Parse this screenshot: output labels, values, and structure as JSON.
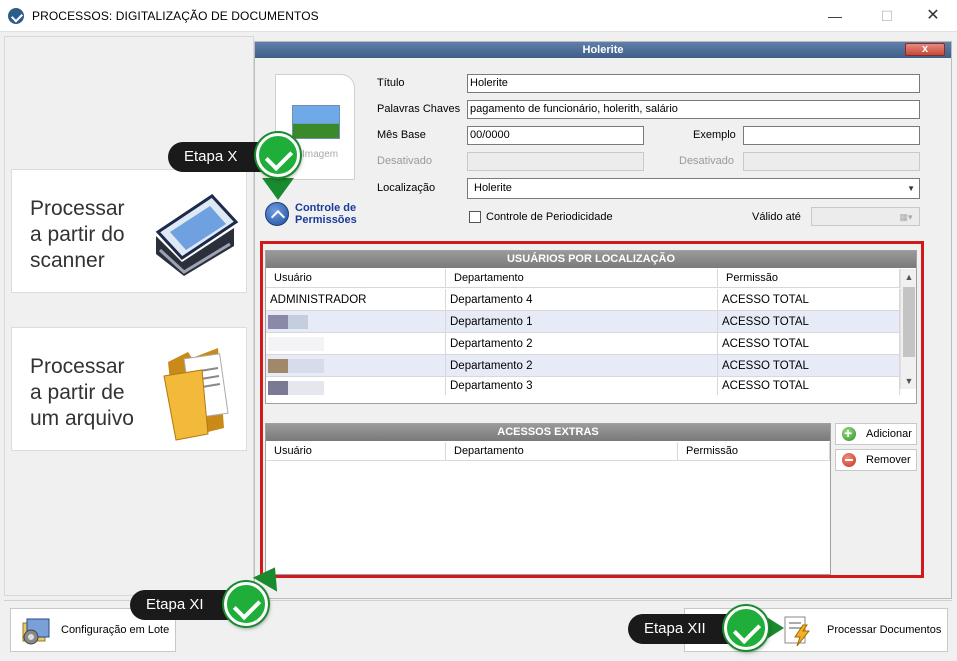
{
  "window": {
    "title": "PROCESSOS: DIGITALIZAÇÃO DE DOCUMENTOS",
    "minimize": "—",
    "maximize": "☐",
    "close": "✕"
  },
  "left": {
    "scanner_label": "Processar\na partir do\nscanner",
    "file_label": "Processar\na partir de\num arquivo"
  },
  "panel": {
    "title": "Holerite",
    "close": "x",
    "image_caption": "Imagem",
    "permissions_label": "Controle de\nPermissões"
  },
  "form": {
    "titulo_label": "Título",
    "titulo_value": "Holerite",
    "palavras_label": "Palavras Chaves",
    "palavras_value": "pagamento de funcionário, holerith, salário",
    "mes_label": "Mês Base",
    "mes_value": "00/0000",
    "exemplo_label": "Exemplo",
    "exemplo_value": "",
    "desativado1_label": "Desativado",
    "desativado2_label": "Desativado",
    "localizacao_label": "Localização",
    "localizacao_value": "Holerite",
    "periodicidade_label": "Controle de Periodicidade",
    "valido_label": "Válido até"
  },
  "usuarios": {
    "title": "USUÁRIOS POR LOCALIZAÇÃO",
    "columns": [
      "Usuário",
      "Departamento",
      "Permissão"
    ],
    "rows": [
      {
        "usuario": "ADMINISTRADOR",
        "departamento": "Departamento 4",
        "permissao": "ACESSO TOTAL"
      },
      {
        "usuario": "",
        "departamento": "Departamento 1",
        "permissao": "ACESSO TOTAL"
      },
      {
        "usuario": "",
        "departamento": "Departamento 2",
        "permissao": "ACESSO TOTAL"
      },
      {
        "usuario": "",
        "departamento": "Departamento 2",
        "permissao": "ACESSO TOTAL"
      },
      {
        "usuario": "",
        "departamento": "Departamento 3",
        "permissao": "ACESSO TOTAL"
      }
    ]
  },
  "acessos": {
    "title": "ACESSOS EXTRAS",
    "columns": [
      "Usuário",
      "Departamento",
      "Permissão"
    ],
    "add_label": "Adicionar",
    "remove_label": "Remover"
  },
  "bottom": {
    "batch_label": "Configuração em Lote",
    "process_label": "Processar Documentos"
  },
  "callouts": {
    "etapa_x": "Etapa X",
    "etapa_xi": "Etapa XI",
    "etapa_xii": "Etapa XII"
  },
  "colors": {
    "highlight_border": "#d21a1a",
    "badge_green": "#1fae3a",
    "panel_header": "#4f6f98"
  }
}
